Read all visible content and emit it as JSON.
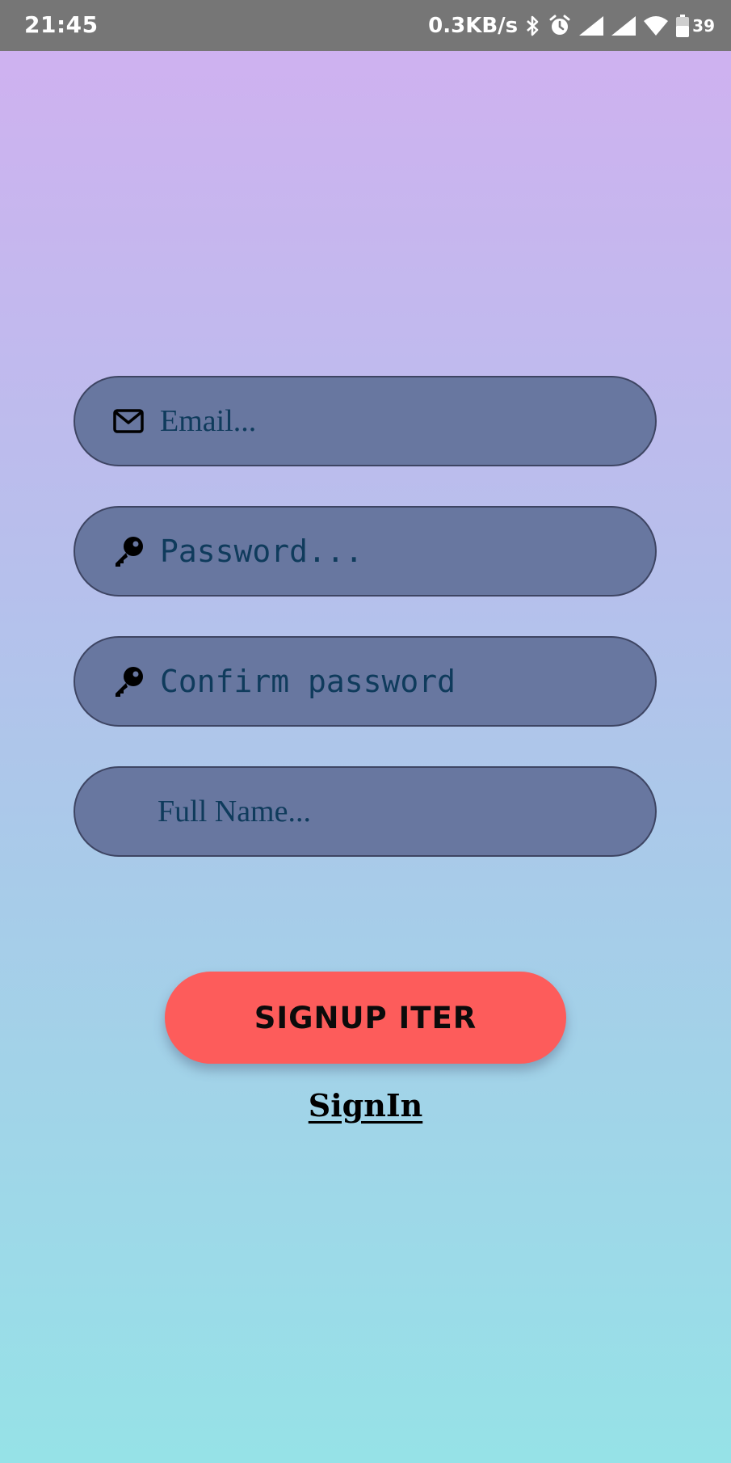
{
  "status_bar": {
    "time": "21:45",
    "net_speed": "0.3KB/s",
    "battery_level": "39",
    "icons": [
      "bluetooth-icon",
      "alarm-icon",
      "signal-icon",
      "signal-icon",
      "wifi-icon",
      "battery-icon"
    ]
  },
  "form": {
    "email": {
      "placeholder": "Email...",
      "icon": "mail-icon"
    },
    "password": {
      "placeholder": "Password...",
      "icon": "key-icon"
    },
    "confirm_password": {
      "placeholder": "Confirm password",
      "icon": "key-icon"
    },
    "full_name": {
      "placeholder": "Full Name..."
    }
  },
  "actions": {
    "signup_label": "SIGNUP ITER",
    "signin_label": "SignIn"
  },
  "colors": {
    "gradient_top": "#d1b0f0",
    "gradient_bottom": "#96e2e7",
    "field_background": "#6877a0",
    "field_text": "#0f3b5c",
    "signup_button": "#fd5c5b",
    "status_bar": "#767676"
  }
}
